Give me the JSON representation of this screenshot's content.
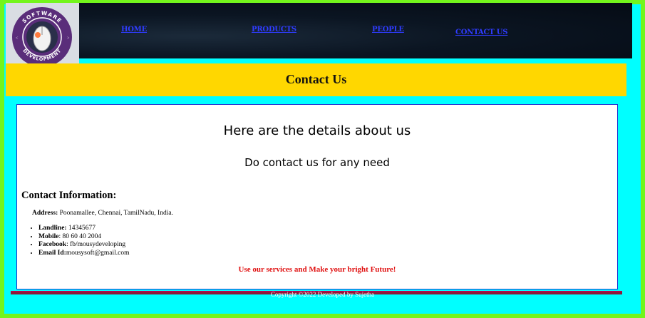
{
  "nav": {
    "home": "HOME",
    "products": "PRODUCTS",
    "people": "PEOPLE",
    "contact": "CONTACT US"
  },
  "logo": {
    "top_text": "SOFTWARE",
    "bottom_text": "DEVELOPMENT"
  },
  "banner": {
    "title": "Contact Us"
  },
  "main": {
    "heading": "Here are the details about us",
    "subheading": "Do contact us for any need",
    "info_title": "Contact Information:",
    "address_label": "Address:",
    "address_value": " Poonamallee, Chennai, TamilNadu, India.",
    "contacts": [
      {
        "label": "Landline:",
        "value": " 14345677"
      },
      {
        "label": "Mobile",
        "value": ": 80 60 40 2004"
      },
      {
        "label": "Facebook",
        "value": ": fb/mousydeveloping"
      },
      {
        "label": "Email Id:",
        "value": "mousysoft@gmail.com"
      }
    ],
    "tagline": "Use our services and Make your bright Future!"
  },
  "footer": {
    "copyright": "Copyright ©2022 Developed by Sujetha"
  },
  "colors": {
    "outer_border": "#73f51c",
    "background": "#00ffff",
    "header_bg": "#050b14",
    "nav_link": "#2f3cff",
    "title_band": "#ffd700",
    "tagline": "#e01010",
    "footer_bar": "#8b1c3a"
  }
}
